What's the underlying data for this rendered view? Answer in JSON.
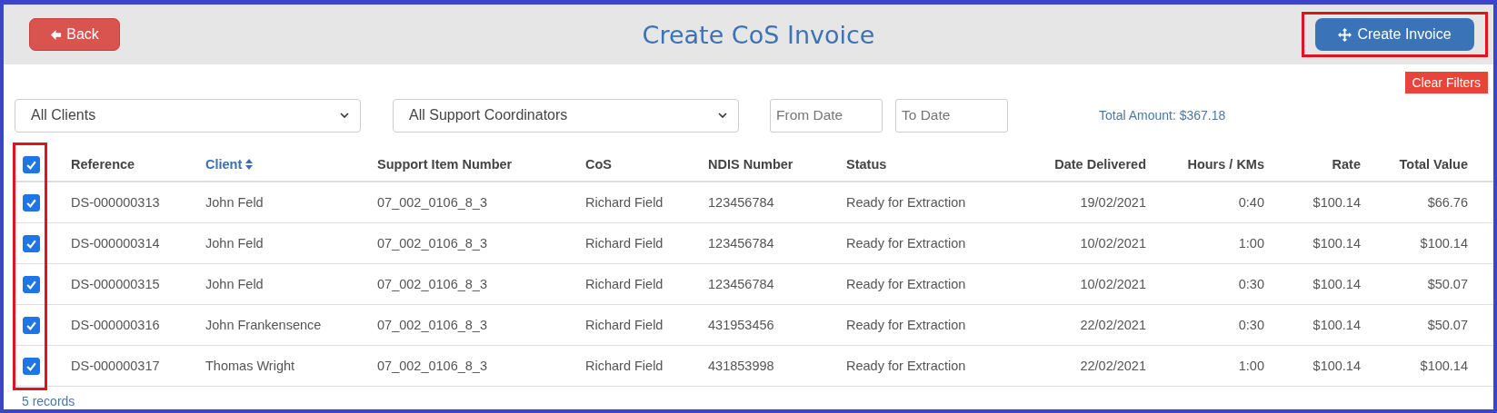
{
  "header": {
    "back_button": "Back",
    "title": "Create CoS Invoice",
    "create_button": {
      "label": "Create Invoice",
      "highlighted": true
    }
  },
  "clear_filters": "Clear Filters",
  "filters": {
    "client_select": "All Clients",
    "coordinator_select": "All Support Coordinators",
    "from_date": {
      "placeholder": "From Date"
    },
    "to_date": {
      "placeholder": "To Date"
    },
    "total_amount": "Total Amount: $367.18"
  },
  "table": {
    "select_all": {
      "checked": true
    },
    "checkbox_column_highlighted": true,
    "columns": [
      {
        "label": "Reference",
        "sorted": false
      },
      {
        "label": "Client",
        "sorted": true
      },
      {
        "label": "Support Item Number",
        "sorted": false
      },
      {
        "label": "CoS",
        "sorted": false
      },
      {
        "label": "NDIS Number",
        "sorted": false
      },
      {
        "label": "Status",
        "sorted": false
      },
      {
        "label": "Date Delivered",
        "sorted": false
      },
      {
        "label": "Hours / KMs",
        "sorted": false
      },
      {
        "label": "Rate",
        "sorted": false
      },
      {
        "label": "Total Value",
        "sorted": false
      }
    ],
    "rows": [
      {
        "checked": true,
        "cells": [
          "DS-000000313",
          "John Feld",
          "07_002_0106_8_3",
          "Richard Field",
          "123456784",
          "Ready for Extraction",
          "19/02/2021",
          "0:40",
          "$100.14",
          "$66.76"
        ]
      },
      {
        "checked": true,
        "cells": [
          "DS-000000314",
          "John Feld",
          "07_002_0106_8_3",
          "Richard Field",
          "123456784",
          "Ready for Extraction",
          "10/02/2021",
          "1:00",
          "$100.14",
          "$100.14"
        ]
      },
      {
        "checked": true,
        "cells": [
          "DS-000000315",
          "John Feld",
          "07_002_0106_8_3",
          "Richard Field",
          "123456784",
          "Ready for Extraction",
          "10/02/2021",
          "0:30",
          "$100.14",
          "$50.07"
        ]
      },
      {
        "checked": true,
        "cells": [
          "DS-000000316",
          "John Frankensence",
          "07_002_0106_8_3",
          "Richard Field",
          "431953456",
          "Ready for Extraction",
          "22/02/2021",
          "0:30",
          "$100.14",
          "$50.07"
        ]
      },
      {
        "checked": true,
        "cells": [
          "DS-000000317",
          "Thomas Wright",
          "07_002_0106_8_3",
          "Richard Field",
          "431853998",
          "Ready for Extraction",
          "22/02/2021",
          "1:00",
          "$100.14",
          "$100.14"
        ]
      }
    ]
  },
  "records_count": "5 records"
}
